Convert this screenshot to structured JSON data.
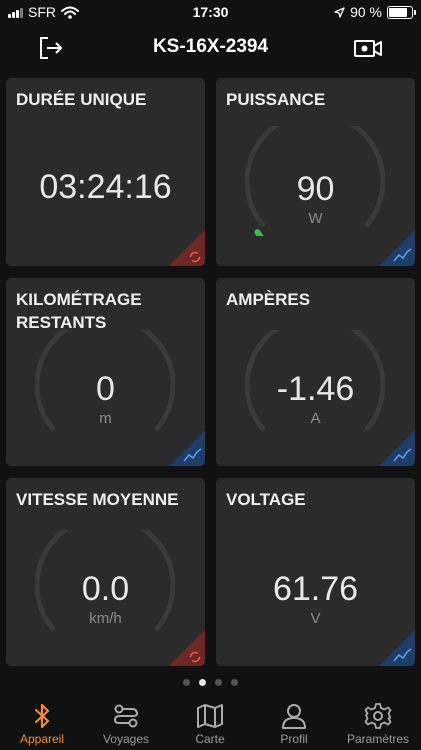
{
  "status_bar": {
    "carrier": "SFR",
    "time": "17:30",
    "battery": "90 %",
    "battery_level": 0.9
  },
  "header": {
    "title": "KS-16X-2394",
    "exit_icon": "exit-icon",
    "camera_icon": "video-camera-icon"
  },
  "cards": [
    {
      "label": "DURÉE UNIQUE",
      "value": "03:24:16",
      "unit": "",
      "corner": "reset"
    },
    {
      "label": "PUISSANCE",
      "value": "90",
      "unit": "W",
      "corner": "chart",
      "gauge_fraction": 0.03
    },
    {
      "label": "KILOMÉTRAGE\nRESTANTS",
      "value": "0",
      "unit": "m",
      "corner": "chart",
      "gauge_fraction": 0
    },
    {
      "label": "AMPÈRES",
      "value": "-1.46",
      "unit": "A",
      "corner": "chart",
      "gauge_fraction": 0
    },
    {
      "label": "VITESSE MOYENNE",
      "value": "0.0",
      "unit": "km/h",
      "corner": "reset",
      "gauge_fraction": 0
    },
    {
      "label": "VOLTAGE",
      "value": "61.76",
      "unit": "V",
      "corner": "chart"
    }
  ],
  "pager": {
    "pages": 4,
    "current": 2
  },
  "tabs": [
    {
      "label": "Appareil",
      "icon": "bluetooth-icon",
      "active": true
    },
    {
      "label": "Voyages",
      "icon": "route-icon",
      "active": false
    },
    {
      "label": "Carte",
      "icon": "map-icon",
      "active": false
    },
    {
      "label": "Profil",
      "icon": "profile-icon",
      "active": false
    },
    {
      "label": "Paramètres",
      "icon": "settings-gear-icon",
      "active": false
    }
  ],
  "colors": {
    "accent": "#f08a3c",
    "gauge_green": "#3fbf3f",
    "corner_blue": "#2f66b8",
    "corner_red": "#b13a3a",
    "card_bg": "#2b2b2b",
    "page_bg": "#111111"
  }
}
